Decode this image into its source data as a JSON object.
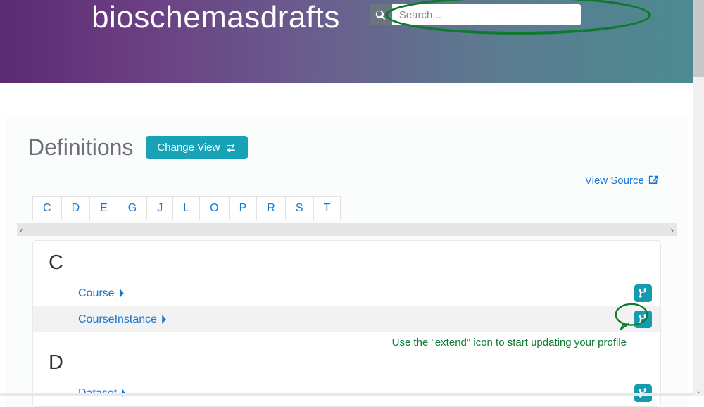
{
  "header": {
    "brand": "bioschemasdrafts",
    "search_placeholder": "Search..."
  },
  "page": {
    "title": "Definitions",
    "change_view_label": "Change View",
    "view_source_label": "View Source"
  },
  "az_letters": [
    "C",
    "D",
    "E",
    "G",
    "J",
    "L",
    "O",
    "P",
    "R",
    "S",
    "T"
  ],
  "sections": [
    {
      "letter": "C",
      "items": [
        {
          "label": "Course",
          "alt": false
        },
        {
          "label": "CourseInstance",
          "alt": true
        }
      ]
    },
    {
      "letter": "D",
      "items": [
        {
          "label": "Dataset",
          "alt": false
        }
      ]
    }
  ],
  "hint": "Use the \"extend\" icon to start updating your profile",
  "colors": {
    "accent": "#17a2b8",
    "link": "#1777d6",
    "annot": "#0d7a2e"
  }
}
